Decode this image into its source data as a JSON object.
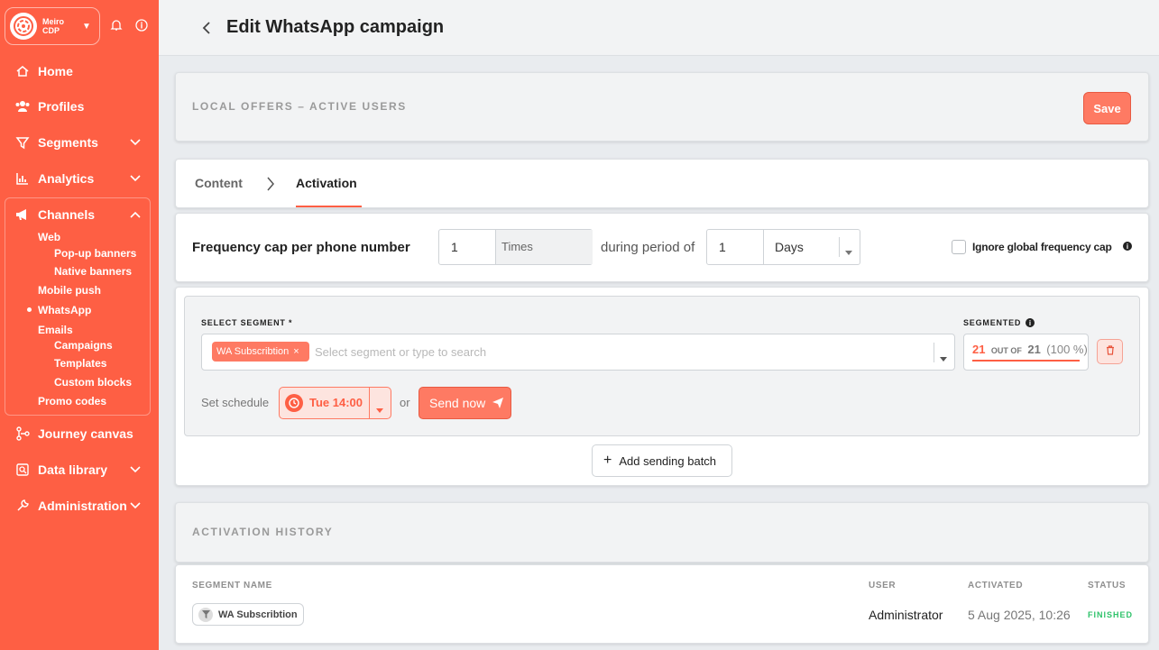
{
  "brand": {
    "name": "Meiro CDP"
  },
  "sidebar": {
    "items": [
      {
        "label": "Home",
        "icon": "home-icon"
      },
      {
        "label": "Profiles",
        "icon": "users-icon"
      },
      {
        "label": "Segments",
        "icon": "filter-icon"
      },
      {
        "label": "Analytics",
        "icon": "bar-chart-icon"
      },
      {
        "label": "Channels",
        "icon": "megaphone-icon"
      },
      {
        "label": "Journey canvas",
        "icon": "journey-icon"
      },
      {
        "label": "Data library",
        "icon": "data-library-icon"
      },
      {
        "label": "Administration",
        "icon": "wrench-icon"
      }
    ],
    "channels": {
      "web": "Web",
      "popup": "Pop-up banners",
      "native": "Native banners",
      "mobile_push": "Mobile push",
      "whatsapp": "WhatsApp",
      "emails": "Emails",
      "campaigns": "Campaigns",
      "templates": "Templates",
      "custom_blocks": "Custom blocks",
      "promo_codes": "Promo codes"
    }
  },
  "header": {
    "title": "Edit WhatsApp campaign"
  },
  "campaign": {
    "name": "LOCAL OFFERS – ACTIVE USERS",
    "save_label": "Save"
  },
  "tabs": {
    "content": "Content",
    "activation": "Activation"
  },
  "frequency": {
    "label": "Frequency cap per phone number",
    "times_value": "1",
    "times_unit": "Times",
    "during": "during period of",
    "period_value": "1",
    "period_unit": "Days",
    "ignore_label": "Ignore global frequency cap"
  },
  "batch": {
    "select_label": "SELECT SEGMENT *",
    "chip": "WA Subscribtion",
    "placeholder": "Select segment or type to search",
    "segmented_label": "SEGMENTED",
    "count": "21",
    "out_of": "OUT OF",
    "total": "21",
    "percent": "(100 %)",
    "set_schedule": "Set schedule",
    "schedule_value": "Tue 14:00",
    "or": "or",
    "send_now": "Send now",
    "add_batch": "Add sending batch"
  },
  "history": {
    "title": "ACTIVATION HISTORY",
    "columns": {
      "segment": "SEGMENT NAME",
      "user": "USER",
      "activated": "ACTIVATED",
      "status": "STATUS"
    },
    "rows": [
      {
        "segment": "WA Subscribtion",
        "user": "Administrator",
        "activated": "5 Aug 2025, 10:26",
        "status": "FINISHED"
      }
    ]
  },
  "colors": {
    "accent": "#fe5f44",
    "accent_light": "#fe7a63",
    "success": "#2ec26a"
  }
}
